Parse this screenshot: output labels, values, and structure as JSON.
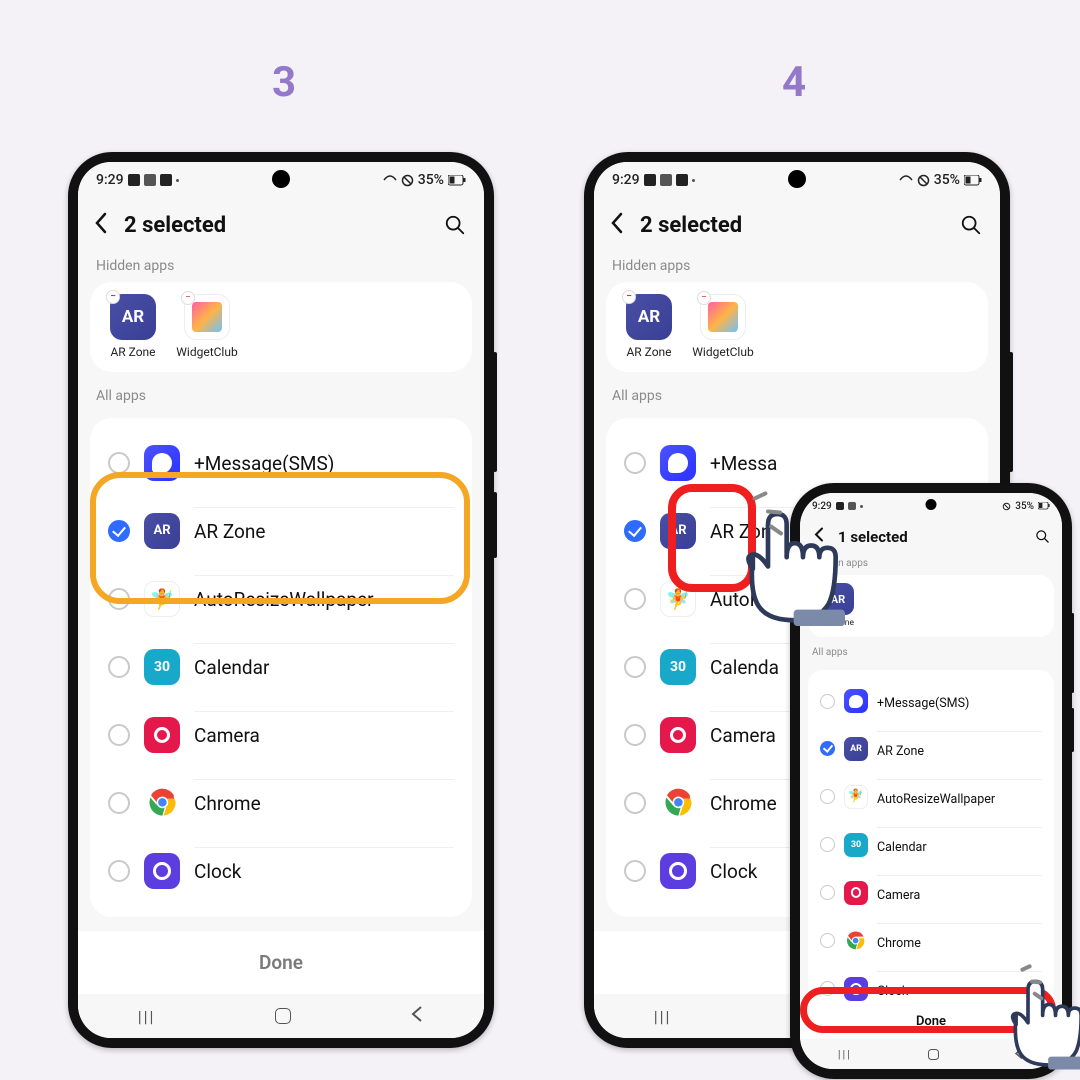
{
  "steps": {
    "s3": "3",
    "s4": "4"
  },
  "status": {
    "time": "9:29",
    "battery": "35%"
  },
  "header": {
    "title2": "2 selected",
    "title1": "1 selected"
  },
  "sections": {
    "hidden": "Hidden apps",
    "all": "All apps"
  },
  "hidden_apps": {
    "ar": "AR Zone",
    "wc": "WidgetClub"
  },
  "apps": {
    "msg": "+Message(SMS)",
    "ar": "AR Zone",
    "arw": "AutoResizeWallpaper",
    "cal": "Calendar",
    "cal_num": "30",
    "cam": "Camera",
    "chrome": "Chrome",
    "chrome_truncated": "Chrome",
    "messa_trunc": "+Messa",
    "autores_trunc": "AutoRes",
    "calenda_trunc": "Calenda",
    "clock": "Clock"
  },
  "done": "Done"
}
